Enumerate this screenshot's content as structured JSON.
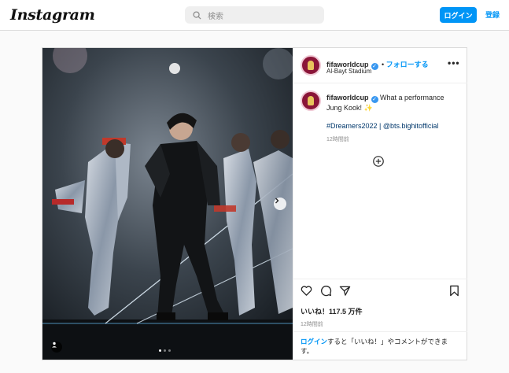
{
  "header": {
    "logo": "Instagram",
    "search_placeholder": "検索",
    "login_button": "ログイン",
    "signup_link": "登録"
  },
  "post": {
    "username": "fifaworldcup",
    "follow_label": "フォローする",
    "location": "Al-Bayt Stadium",
    "caption_text": "What a performance Jung Kook! ✨",
    "hashtags": "#Dreamers2022 | @bts.bighitofficial",
    "comment_time": "12時間前",
    "likes": "いいね！117.5 万件",
    "post_time": "12時間前",
    "login_prompt_link": "ログイン",
    "login_prompt_text": "すると「いいね！」やコメントができます。",
    "carousel": {
      "total": 3,
      "active": 1
    }
  },
  "colors": {
    "accent": "#0095f6",
    "border": "#dbdbdb",
    "fifa": "#8a1538"
  }
}
